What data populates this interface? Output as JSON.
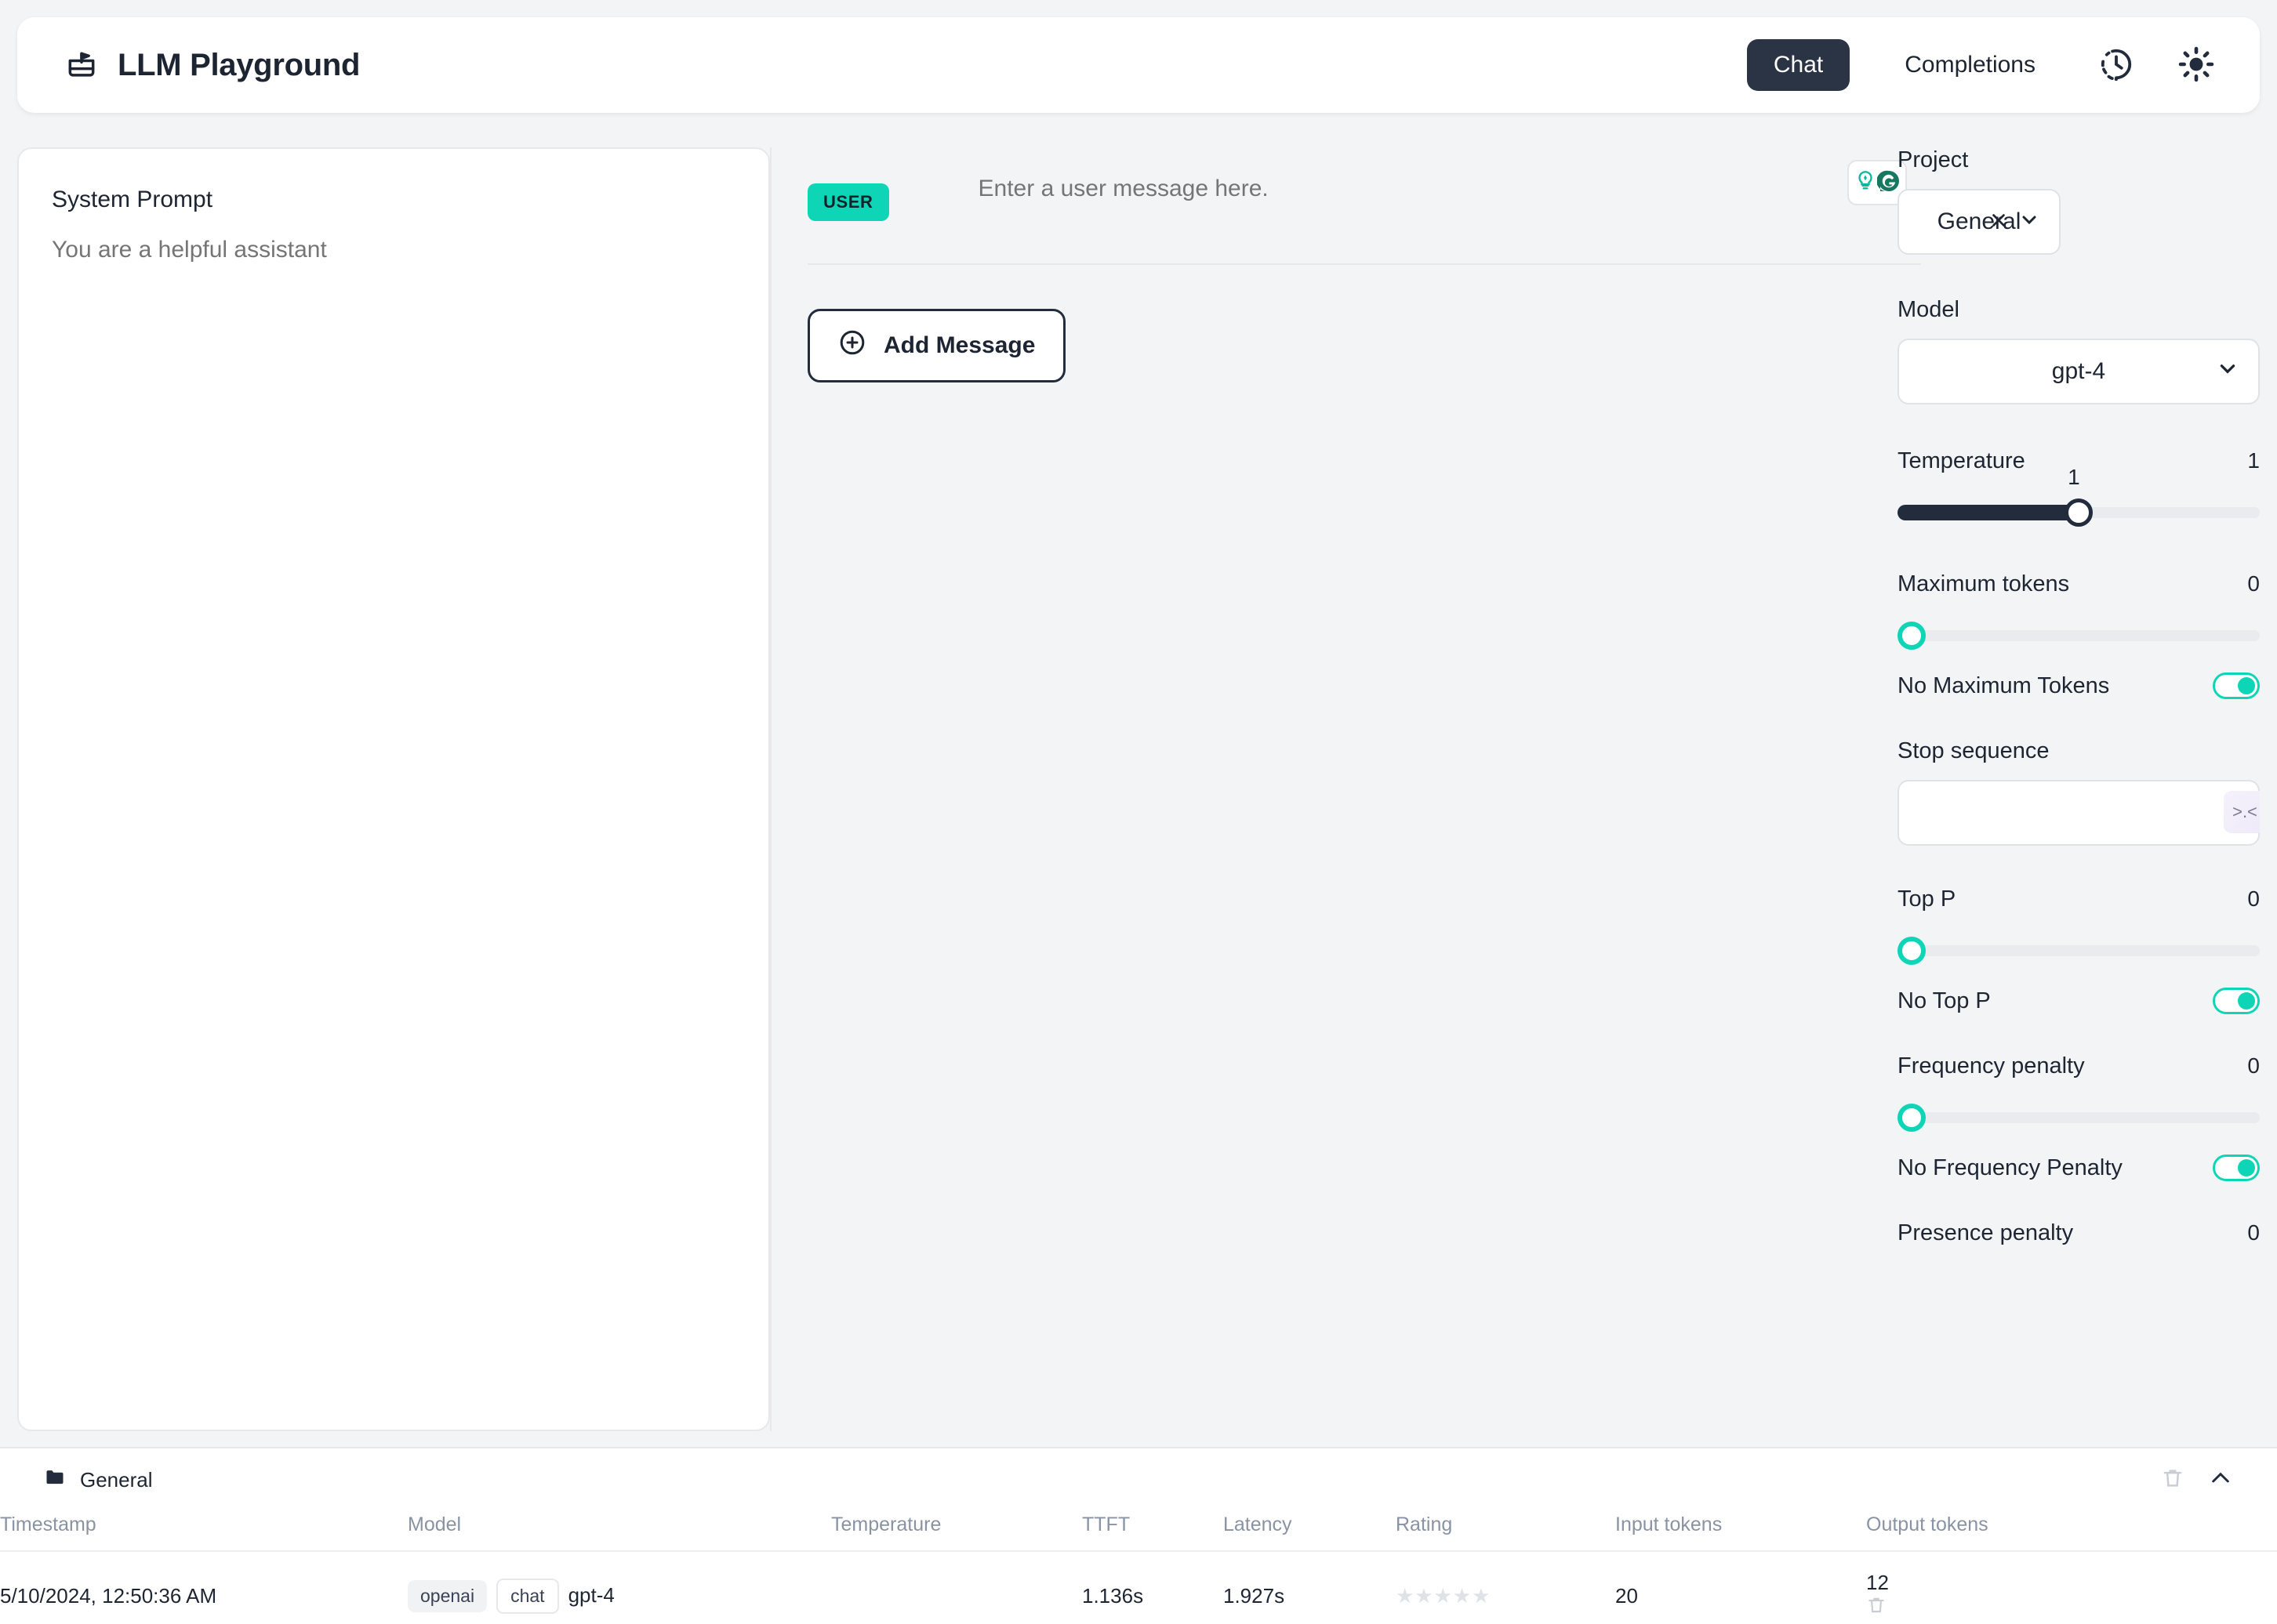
{
  "header": {
    "title": "LLM Playground",
    "logo_icon": "playground-sandbox-icon",
    "tabs": [
      {
        "label": "Chat",
        "active": true
      },
      {
        "label": "Completions",
        "active": false
      }
    ],
    "history_icon": "history-clock-icon",
    "theme_icon": "sun-icon"
  },
  "system_prompt": {
    "title": "System Prompt",
    "placeholder": "You are a helpful assistant",
    "value": ""
  },
  "chat": {
    "message": {
      "role": "USER",
      "placeholder": "Enter a user message here.",
      "value": ""
    },
    "grammarly_icons": [
      "lightbulb-icon",
      "grammarly-g-icon"
    ],
    "add_message_label": "Add Message",
    "add_message_icon": "plus-circle-icon"
  },
  "sidebar": {
    "project": {
      "label": "Project",
      "value": "General",
      "clear_icon": "close-icon",
      "chevron_icon": "chevron-down-icon"
    },
    "model": {
      "label": "Model",
      "value": "gpt-4",
      "chevron_icon": "chevron-down-icon"
    },
    "temperature": {
      "label": "Temperature",
      "value": "1",
      "bubble": "1",
      "percent": 50
    },
    "maximum_tokens": {
      "label": "Maximum tokens",
      "value": "0",
      "percent": 0,
      "toggle_label": "No Maximum Tokens",
      "toggle_on": true
    },
    "stop_sequence": {
      "label": "Stop sequence",
      "value": "",
      "placeholder": "",
      "badge": "&gt;.&lt;"
    },
    "top_p": {
      "label": "Top P",
      "value": "0",
      "percent": 0,
      "toggle_label": "No Top P",
      "toggle_on": true
    },
    "frequency_penalty": {
      "label": "Frequency penalty",
      "value": "0",
      "percent": 0,
      "toggle_label": "No Frequency Penalty",
      "toggle_on": true
    },
    "presence_penalty": {
      "label": "Presence penalty",
      "value": "0"
    }
  },
  "bottom": {
    "project_name": "General",
    "folder_icon": "folder-icon",
    "delete_icon": "trash-icon",
    "collapse_icon": "chevron-up-icon",
    "columns": [
      "Timestamp",
      "Model",
      "Temperature",
      "TTFT",
      "Latency",
      "Rating",
      "Input tokens",
      "Output tokens"
    ],
    "rows": [
      {
        "timestamp": "5/10/2024, 12:50:36 AM",
        "model_tags": [
          "openai",
          "chat"
        ],
        "model_name": "gpt-4",
        "temperature": "",
        "ttft": "1.136s",
        "latency": "1.927s",
        "rating": 0,
        "rating_max": 5,
        "input_tokens": "20",
        "output_tokens": "12"
      }
    ]
  },
  "colors": {
    "accent_teal": "#0ed5b6",
    "dark": "#222c3c",
    "muted": "#9aa3b0"
  }
}
